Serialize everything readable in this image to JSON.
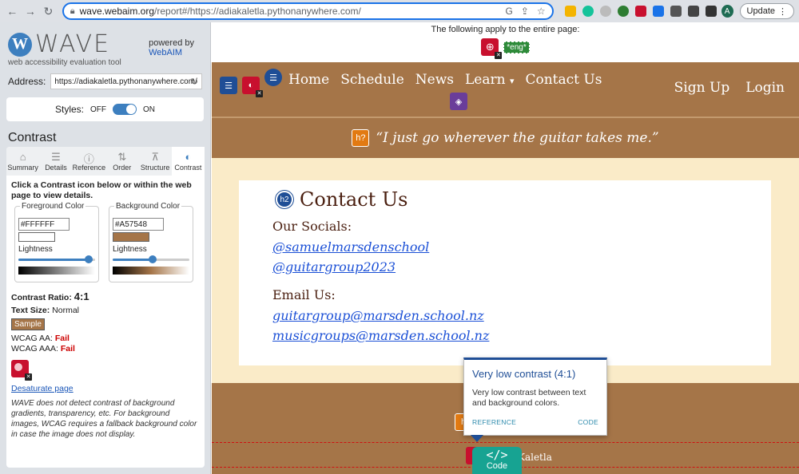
{
  "browser": {
    "url_host": "wave.webaim.org",
    "url_path": "/report#/https://adiakaletla.pythonanywhere.com/",
    "profile_initial": "A",
    "update_label": "Update"
  },
  "wave": {
    "logo_letter": "W",
    "logo_word": "WAVE",
    "tagline": "web accessibility evaluation tool",
    "powered_by": "powered by",
    "webaim_link": "WebAIM",
    "address_label": "Address:",
    "address_value": "https://adiakaletla.pythonanywhere.com/",
    "styles_label": "Styles:",
    "styles_off": "OFF",
    "styles_on": "ON",
    "section_title": "Contrast",
    "tabs": [
      {
        "label": "Summary",
        "icon": "home-icon",
        "glyph": "⌂"
      },
      {
        "label": "Details",
        "icon": "list-icon",
        "glyph": "☰"
      },
      {
        "label": "Reference",
        "icon": "info-icon",
        "glyph": "ⓘ"
      },
      {
        "label": "Order",
        "icon": "order-icon",
        "glyph": "⇅"
      },
      {
        "label": "Structure",
        "icon": "structure-icon",
        "glyph": "⊼"
      },
      {
        "label": "Contrast",
        "icon": "contrast-icon",
        "glyph": "◐"
      }
    ],
    "instructions": "Click a Contrast icon below or within the web page to view details.",
    "foreground": {
      "legend": "Foreground Color",
      "hex": "#FFFFFF",
      "lightness_label": "Lightness",
      "lightness": 0.97
    },
    "background": {
      "legend": "Background Color",
      "hex": "#A57548",
      "lightness_label": "Lightness",
      "lightness": 0.52
    },
    "ratio_label": "Contrast Ratio:",
    "ratio_value": "4:1",
    "text_size_label": "Text Size:",
    "text_size_value": "Normal",
    "sample": "Sample",
    "aa_label": "WCAG AA:",
    "aa_value": "Fail",
    "aaa_label": "WCAG AAA:",
    "aaa_value": "Fail",
    "desaturate": "Desaturate page",
    "note": "WAVE does not detect contrast of background gradients, transparency, etc. For background images, WCAG requires a fallback background color in case the image does not display."
  },
  "page": {
    "apply_text": "The following apply to the entire page:",
    "lang_tag": "*eng*",
    "nav": [
      "Home",
      "Schedule",
      "News",
      "Learn",
      "Contact Us"
    ],
    "nav_right": [
      "Sign Up",
      "Login"
    ],
    "quote": "“I just go wherever the guitar takes me.”",
    "h2_icon": "h2",
    "heading": "Contact Us",
    "socials_label": "Our Socials:",
    "socials": [
      "@samuelmarsdenschool",
      "@guitargroup2023"
    ],
    "email_label": "Email Us:",
    "emails": [
      "guitargroup@marsden.school.nz",
      "musicgroups@marsden.school.nz"
    ],
    "footer_text": "Kaletla"
  },
  "tooltip": {
    "title": "Very low contrast (4:1)",
    "body": "Very low contrast between text and background colors.",
    "reference": "REFERENCE",
    "code": "CODE"
  },
  "code_button": {
    "symbol": "</>",
    "label": "Code"
  },
  "colors": {
    "accent": "#3d7fbf",
    "page_brown": "#a57548",
    "cream": "#faebc8",
    "error_red": "#c8102e"
  }
}
